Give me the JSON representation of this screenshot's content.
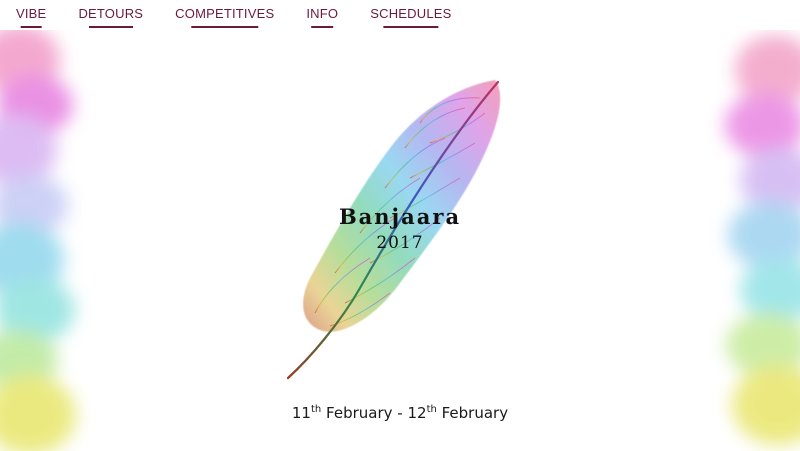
{
  "nav": {
    "items": [
      {
        "label": "VIBE"
      },
      {
        "label": "DETOURS"
      },
      {
        "label": "COMPETITIVES"
      },
      {
        "label": "INFO"
      },
      {
        "label": "SCHEDULES"
      }
    ]
  },
  "hero": {
    "title": "Banjaara",
    "year": "2017",
    "date_start_day": "11",
    "date_start_suffix": "th",
    "date_start_month": "February",
    "date_separator": "-",
    "date_end_day": "12",
    "date_end_suffix": "th",
    "date_end_month": "February",
    "emblem_icon": "rainbow-feather-icon"
  },
  "colors": {
    "nav_text": "#6a1a3a",
    "title_text": "#111111"
  }
}
